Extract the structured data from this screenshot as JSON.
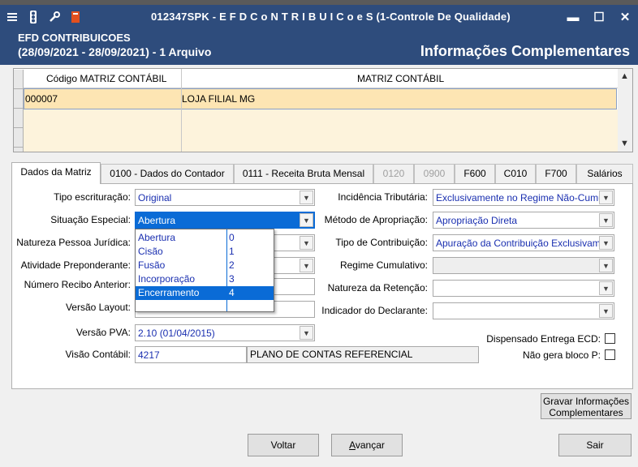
{
  "window": {
    "title": "012347SPK - E F D  C o N T R I B U I C o e S (1-Controle De Qualidade)",
    "icons": [
      "menu-icon",
      "traffic-light-icon",
      "wrench-icon",
      "book-icon"
    ],
    "controls": {
      "minimize": "▬",
      "maximize": "☐",
      "close": "✕"
    }
  },
  "header": {
    "line1": "EFD CONTRIBUICOES",
    "line2": "(28/09/2021 - 28/09/2021) - 1 Arquivo",
    "section_title": "Informações Complementares"
  },
  "grid": {
    "columns": [
      "Código MATRIZ CONTÁBIL",
      "MATRIZ CONTÁBIL"
    ],
    "rows": [
      {
        "codigo": "000007",
        "matriz": "LOJA FILIAL MG"
      }
    ]
  },
  "tabs": [
    {
      "label": "Dados da Matriz",
      "state": "active"
    },
    {
      "label": "0100 - Dados do Contador",
      "state": "normal"
    },
    {
      "label": "0111 - Receita Bruta Mensal",
      "state": "normal"
    },
    {
      "label": "0120",
      "state": "disabled"
    },
    {
      "label": "0900",
      "state": "disabled"
    },
    {
      "label": "F600",
      "state": "normal"
    },
    {
      "label": "C010",
      "state": "normal"
    },
    {
      "label": "F700",
      "state": "normal"
    },
    {
      "label": "Salários",
      "state": "normal"
    }
  ],
  "form": {
    "tipo_escrituracao": {
      "label": "Tipo escrituração:",
      "value": "Original"
    },
    "situacao_especial": {
      "label": "Situação Especial:",
      "value": "Abertura"
    },
    "natureza_pj": {
      "label": "Natureza Pessoa Jurídica:",
      "value": ""
    },
    "atividade_preponderante": {
      "label": "Atividade Preponderante:",
      "value": ""
    },
    "numero_recibo": {
      "label": "Número Recibo Anterior:",
      "value": ""
    },
    "versao_layout": {
      "label": "Versão Layout:",
      "value": ""
    },
    "versao_pva": {
      "label": "Versão PVA:",
      "value": "2.10 (01/04/2015)"
    },
    "visao_contabil": {
      "label": "Visão Contábil:",
      "code": "4217",
      "description": "PLANO DE CONTAS REFERENCIAL"
    },
    "incidencia_tributaria": {
      "label": "Incidência Tributária:",
      "value": "Exclusivamente no Regime Não-Cumu"
    },
    "metodo_apropriacao": {
      "label": "Método de Apropriação:",
      "value": "Apropriação Direta"
    },
    "tipo_contribuicao": {
      "label": "Tipo de Contribuição:",
      "value": "Apuração da Contribuição Exclusivam"
    },
    "regime_cumulativo": {
      "label": "Regime Cumulativo:",
      "value": ""
    },
    "natureza_retencao": {
      "label": "Natureza da Retenção:",
      "value": ""
    },
    "indicador_declarante": {
      "label": "Indicador do Declarante:",
      "value": ""
    },
    "dispensado_ecd": {
      "label": "Dispensado Entrega ECD:",
      "checked": false
    },
    "nao_gera_bloco_p": {
      "label": "Não gera bloco P:",
      "checked": false
    }
  },
  "dropdown": {
    "items": [
      {
        "name": "Abertura",
        "code": "0"
      },
      {
        "name": "Cisão",
        "code": "1"
      },
      {
        "name": "Fusão",
        "code": "2"
      },
      {
        "name": "Incorporação",
        "code": "3"
      },
      {
        "name": "Encerramento",
        "code": "4"
      }
    ],
    "selected_index": 4
  },
  "buttons": {
    "gravar": [
      "Gravar Informações",
      "Complementares"
    ],
    "voltar": "Voltar",
    "avancar_u": "A",
    "avancar_rest": "vançar",
    "sair": "Sair"
  },
  "colors": {
    "title_bg": "#2e4c7c",
    "selection": "#0a6bd6",
    "row_highlight": "#fde5b3",
    "value_text": "#1a2fb0"
  }
}
